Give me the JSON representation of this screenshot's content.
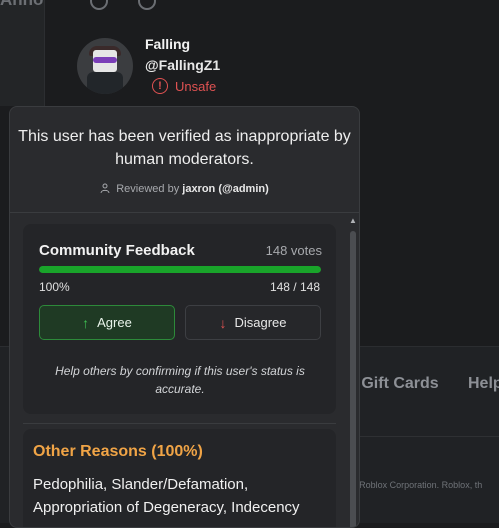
{
  "background": {
    "left_text": "Anno",
    "footer_links": [
      "y Gift Cards",
      "Help"
    ],
    "copyright": "© Roblox Corporation. Roblox, th"
  },
  "profile": {
    "display_name": "Falling",
    "username": "@FallingZ1",
    "status": "Unsafe",
    "status_icon": "alert-circle-icon",
    "status_color": "#e05252"
  },
  "verification": {
    "message": "This user has been verified as inappropriate by human moderators.",
    "reviewed_prefix": "Reviewed by",
    "reviewer": "jaxron (@admin)"
  },
  "feedback": {
    "title": "Community Feedback",
    "votes_label": "148 votes",
    "agree_fraction": 1.0,
    "percent_label": "100%",
    "count_label": "148 / 148",
    "agree_label": "Agree",
    "disagree_label": "Disagree",
    "help_text": "Help others by confirming if this user's status is accurate.",
    "bar_color": "#19a42a"
  },
  "reasons": {
    "title": "Other Reasons (100%)",
    "list": "Pedophilia, Slander/Defamation, Appropriation of Degeneracy, Indecency",
    "title_color": "#f0a446"
  }
}
